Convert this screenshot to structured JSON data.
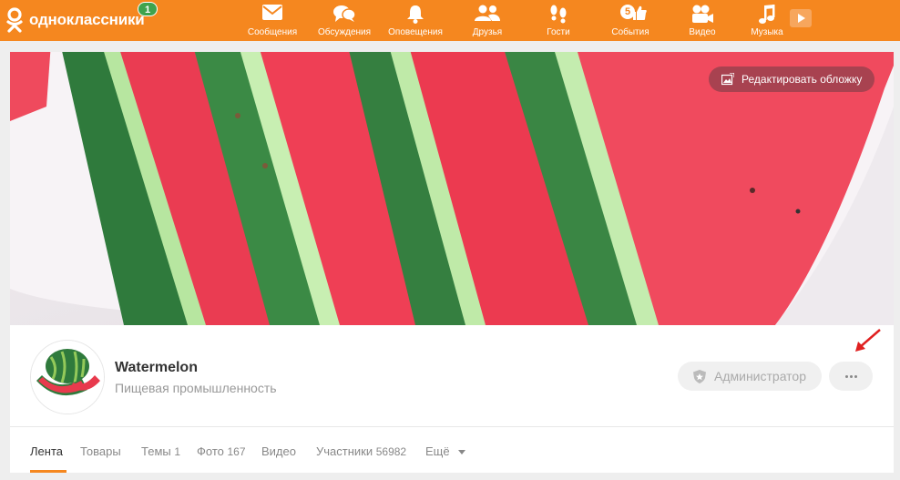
{
  "header": {
    "logo_text": "одноклассники",
    "logo_badge": "1",
    "brand_color": "#f5871f",
    "nav": [
      {
        "id": "messages",
        "label": "Сообщения",
        "icon": "envelope-icon"
      },
      {
        "id": "discussions",
        "label": "Обсуждения",
        "icon": "chat-bubbles-icon"
      },
      {
        "id": "notifications",
        "label": "Оповещения",
        "icon": "bell-icon"
      },
      {
        "id": "friends",
        "label": "Друзья",
        "icon": "people-icon"
      },
      {
        "id": "guests",
        "label": "Гости",
        "icon": "footprints-icon"
      },
      {
        "id": "events",
        "label": "События",
        "icon": "thumbs-up-icon",
        "badge": "5"
      },
      {
        "id": "video",
        "label": "Видео",
        "icon": "camera-icon"
      },
      {
        "id": "music",
        "label": "Музыка",
        "icon": "music-note-icon"
      }
    ]
  },
  "cover": {
    "edit_label": "Редактировать обложку"
  },
  "group": {
    "name": "Watermelon",
    "category": "Пищевая промышленность"
  },
  "actions": {
    "admin_label": "Администратор",
    "more_icon": "more-dots-icon"
  },
  "tabs": [
    {
      "label": "Лента",
      "count": ""
    },
    {
      "label": "Товары",
      "count": ""
    },
    {
      "label": "Темы",
      "count": "1"
    },
    {
      "label": "Фото",
      "count": "167"
    },
    {
      "label": "Видео",
      "count": ""
    },
    {
      "label": "Участники",
      "count": "56982"
    },
    {
      "label": "Ещё",
      "count": ""
    }
  ]
}
